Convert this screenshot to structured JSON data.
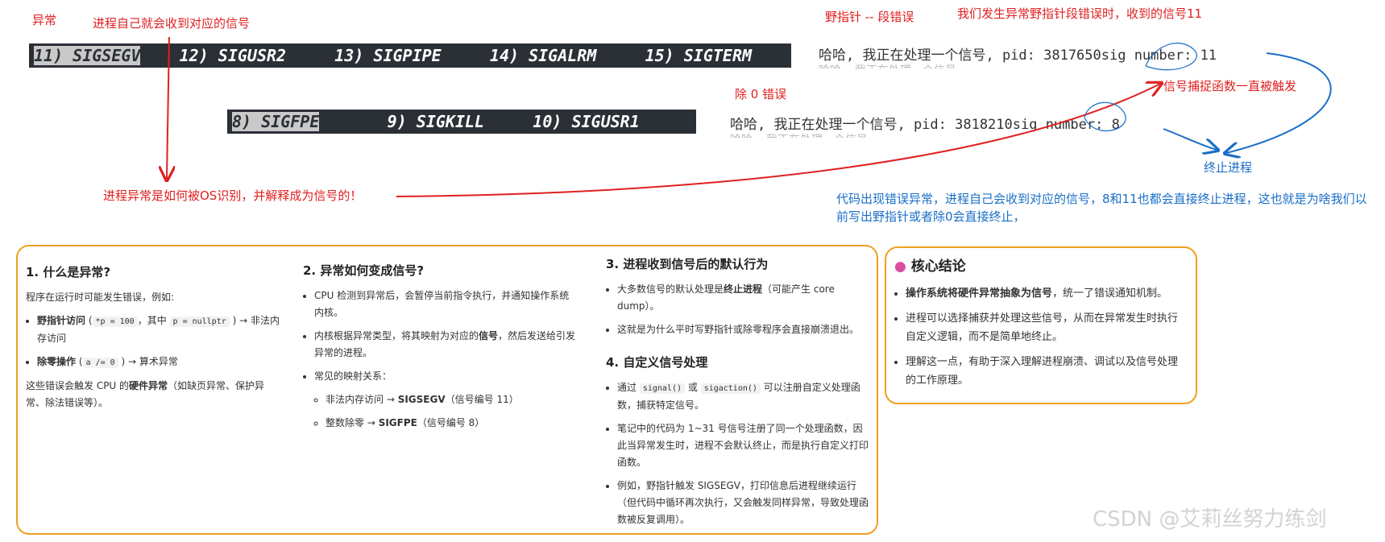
{
  "annotations": {
    "exception": "异常",
    "process_receives": "进程自己就会收到对应的信号",
    "wild_pointer": "野指针 -- 段错误",
    "wild_pointer_signal": "我们发生异常野指针段错误时，收到的信号11",
    "div_zero": "除 0 错误",
    "handler_triggered": "信号捕捉函数一直被触发",
    "terminate": "终止进程",
    "os_question": "进程异常是如何被OS识别，并解释成为信号的！",
    "code_error_note": "代码出现错误异常，进程自己会收到对应的信号，8和11也都会直接终止进程，这也就是为啥我们以前写出野指针或者除0会直接终止，"
  },
  "terminal1": {
    "hl": "11) SIGSEGV",
    "rest": "    12) SIGUSR2     13) SIGPIPE     14) SIGALRM     15) SIGTERM"
  },
  "terminal2": {
    "hl": "8) SIGFPE",
    "rest": "       9) SIGKILL     10) SIGUSR1"
  },
  "output1": "哈哈, 我正在处理一个信号, pid: 3817650sig number: 11",
  "output2": "哈哈, 我正在处理一个信号, pid: 3818210sig number: 8",
  "output_blur": "哈哈, 我正在处理一个信号",
  "sections": {
    "s1": {
      "title": "1. 什么是异常?",
      "intro": "程序在运行时可能发生错误，例如:",
      "item1_bold": "野指针访问",
      "item1_code1": "*p = 100",
      "item1_mid": "，其中",
      "item1_code2": "p = nullptr",
      "item1_tail": ") → 非法内存访问",
      "item2_bold": "除零操作",
      "item2_code": "a /= 0",
      "item2_tail": ") → 算术异常",
      "outro_pre": "这些错误会触发 CPU 的",
      "outro_bold": "硬件异常",
      "outro_tail": "（如缺页异常、保护异常、除法错误等）。"
    },
    "s2": {
      "title": "2. 异常如何变成信号?",
      "li1": "CPU 检测到异常后，会暂停当前指令执行，并通知操作系统内核。",
      "li2_pre": "内核根据异常类型，将其映射为对应的",
      "li2_bold": "信号",
      "li2_tail": "，然后发送给引发异常的进程。",
      "li3": "常见的映射关系：",
      "sub1_pre": "非法内存访问 → ",
      "sub1_bold": "SIGSEGV",
      "sub1_tail": "（信号编号 11）",
      "sub2_pre": "整数除零 → ",
      "sub2_bold": "SIGFPE",
      "sub2_tail": "（信号编号 8）"
    },
    "s3": {
      "title": "3. 进程收到信号后的默认行为",
      "li1_pre": "大多数信号的默认处理是",
      "li1_bold": "终止进程",
      "li1_tail": "（可能产生 core dump）。",
      "li2": "这就是为什么平时写野指针或除零程序会直接崩溃退出。"
    },
    "s4": {
      "title": "4. 自定义信号处理",
      "li1_pre": "通过",
      "li1_code1": "signal()",
      "li1_mid": "或",
      "li1_code2": "sigaction()",
      "li1_tail": "可以注册自定义处理函数，捕获特定信号。",
      "li2": "笔记中的代码为 1~31 号信号注册了同一个处理函数，因此当异常发生时，进程不会默认终止，而是执行自定义打印函数。",
      "li3": "例如，野指针触发 SIGSEGV，打印信息后进程继续运行（但代码中循环再次执行，又会触发同样异常，导致处理函数被反复调用）。"
    },
    "core": {
      "title": "核心结论",
      "li1_bold": "操作系统将硬件异常抽象为信号",
      "li1_tail": "，统一了错误通知机制。",
      "li2": "进程可以选择捕获并处理这些信号，从而在异常发生时执行自定义逻辑，而不是简单地终止。",
      "li3": "理解这一点，有助于深入理解进程崩溃、调试以及信号处理的工作原理。"
    }
  },
  "watermark": "CSDN @艾莉丝努力练剑",
  "colors": {
    "annotation_red": "#e02020",
    "annotation_blue": "#1a6ec7",
    "card_border": "#f0a020",
    "terminal_bg": "#2b2f36"
  }
}
